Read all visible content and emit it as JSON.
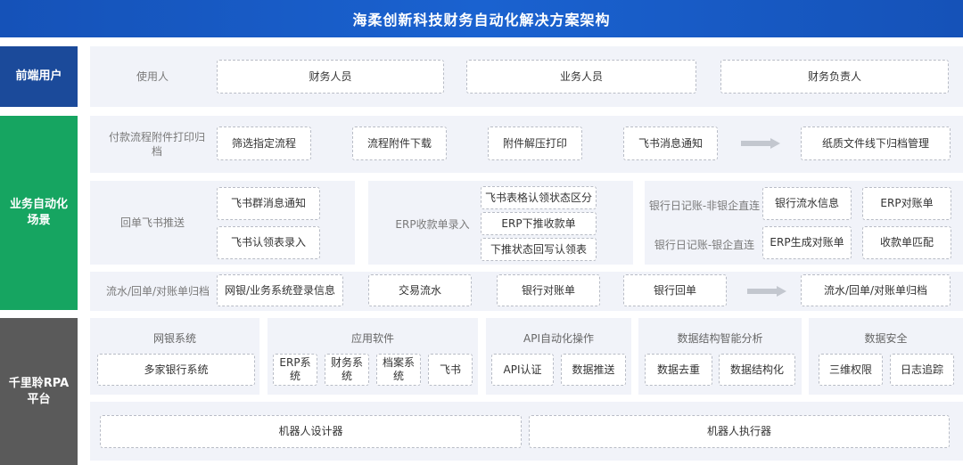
{
  "title": "海柔创新科技财务自动化解决方案架构",
  "sections": {
    "frontend": "前端用户",
    "business": "业务自动化场景",
    "platform": "千里聆RPA平台"
  },
  "frontend_row": {
    "label": "使用人",
    "items": [
      "财务人员",
      "业务人员",
      "财务负责人"
    ]
  },
  "payment_row": {
    "label": "付款流程附件打印归档",
    "steps": [
      "筛选指定流程",
      "流程附件下载",
      "附件解压打印",
      "飞书消息通知",
      "纸质文件线下归档管理"
    ]
  },
  "receipt_panel": {
    "label": "回单飞书推送",
    "items": [
      "飞书群消息通知",
      "飞书认领表录入"
    ]
  },
  "erp_panel": {
    "label": "ERP收款单录入",
    "items": [
      "飞书表格认领状态区分",
      "ERP下推收款单",
      "下推状态回写认领表"
    ]
  },
  "bank_panel": {
    "label_top": "银行日记账-非银企直连",
    "label_bottom": "银行日记账-银企直连",
    "items": [
      "银行流水信息",
      "ERP对账单",
      "ERP生成对账单",
      "收款单匹配"
    ]
  },
  "archive_row": {
    "label": "流水/回单/对账单归档",
    "steps": [
      "网银/业务系统登录信息",
      "交易流水",
      "银行对账单",
      "银行回单",
      "流水/回单/对账单归档"
    ]
  },
  "platform_modules": [
    {
      "title": "网银系统",
      "items": [
        "多家银行系统"
      ]
    },
    {
      "title": "应用软件",
      "items": [
        "ERP系统",
        "财务系统",
        "档案系统",
        "飞书"
      ]
    },
    {
      "title": "API自动化操作",
      "items": [
        "API认证",
        "数据推送"
      ]
    },
    {
      "title": "数据结构智能分析",
      "items": [
        "数据去重",
        "数据结构化"
      ]
    },
    {
      "title": "数据安全",
      "items": [
        "三维权限",
        "日志追踪"
      ]
    }
  ],
  "robot_row": [
    "机器人设计器",
    "机器人执行器"
  ],
  "colors": {
    "title_bar": "#1552b8",
    "frontend_side": "#1b4a9a",
    "business_side": "#16a561",
    "platform_side": "#5a5a5a",
    "panel_bg": "#f1f3f9"
  },
  "icons": {
    "flow_arrow": "right-arrow-icon"
  }
}
